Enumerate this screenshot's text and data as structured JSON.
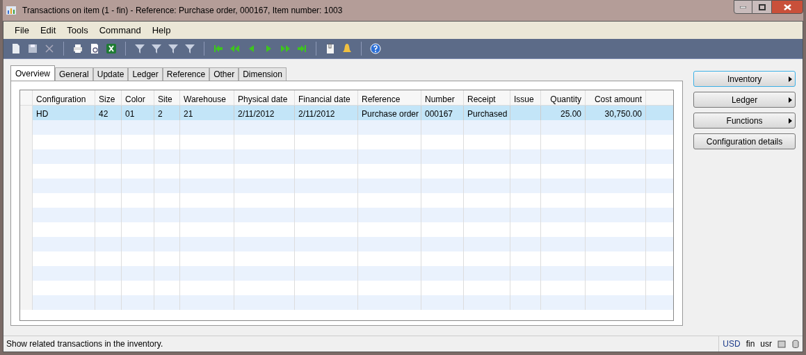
{
  "window": {
    "title": "Transactions on item (1 - fin) - Reference: Purchase order, 000167, Item number: 1003"
  },
  "menu": [
    "File",
    "Edit",
    "Tools",
    "Command",
    "Help"
  ],
  "toolbar": [
    {
      "kind": "doc"
    },
    {
      "kind": "save"
    },
    {
      "kind": "cross"
    },
    {
      "kind": "sep"
    },
    {
      "kind": "print"
    },
    {
      "kind": "preview"
    },
    {
      "kind": "sheet"
    },
    {
      "kind": "sep"
    },
    {
      "kind": "filter"
    },
    {
      "kind": "filter"
    },
    {
      "kind": "filter"
    },
    {
      "kind": "filter"
    },
    {
      "kind": "sep"
    },
    {
      "kind": "first"
    },
    {
      "kind": "prevpage"
    },
    {
      "kind": "prev"
    },
    {
      "kind": "next"
    },
    {
      "kind": "nextpage"
    },
    {
      "kind": "last"
    },
    {
      "kind": "sep"
    },
    {
      "kind": "clip"
    },
    {
      "kind": "bell"
    },
    {
      "kind": "sep"
    },
    {
      "kind": "help"
    }
  ],
  "tabs": [
    {
      "label": "Overview",
      "selected": true
    },
    {
      "label": "General",
      "selected": false
    },
    {
      "label": "Update",
      "selected": false
    },
    {
      "label": "Ledger",
      "selected": false
    },
    {
      "label": "Reference",
      "selected": false
    },
    {
      "label": "Other",
      "selected": false
    },
    {
      "label": "Dimension",
      "selected": false
    }
  ],
  "table": {
    "columns": [
      {
        "label": "Configuration",
        "numeric": false
      },
      {
        "label": "Size",
        "numeric": false
      },
      {
        "label": "Color",
        "numeric": false
      },
      {
        "label": "Site",
        "numeric": false
      },
      {
        "label": "Warehouse",
        "numeric": false
      },
      {
        "label": "Physical date",
        "numeric": false
      },
      {
        "label": "Financial date",
        "numeric": false
      },
      {
        "label": "Reference",
        "numeric": false
      },
      {
        "label": "Number",
        "numeric": false
      },
      {
        "label": "Receipt",
        "numeric": false
      },
      {
        "label": "Issue",
        "numeric": false
      },
      {
        "label": "Quantity",
        "numeric": true
      },
      {
        "label": "Cost amount",
        "numeric": true
      }
    ],
    "rows": [
      {
        "selected": true,
        "cells": [
          "HD",
          "42",
          "01",
          "2",
          "21",
          "2/11/2012",
          "2/11/2012",
          "Purchase order",
          "000167",
          "Purchased",
          "",
          "25.00",
          "30,750.00"
        ]
      }
    ]
  },
  "buttons": [
    {
      "label": "Inventory",
      "submenu": true,
      "selected": true
    },
    {
      "label": "Ledger",
      "submenu": true,
      "selected": false
    },
    {
      "label": "Functions",
      "submenu": true,
      "selected": false
    },
    {
      "label": "Configuration details",
      "submenu": false,
      "selected": false
    }
  ],
  "status_bar": {
    "message": "Show related transactions in the inventory.",
    "fields": [
      "USD",
      "fin",
      "usr"
    ]
  }
}
